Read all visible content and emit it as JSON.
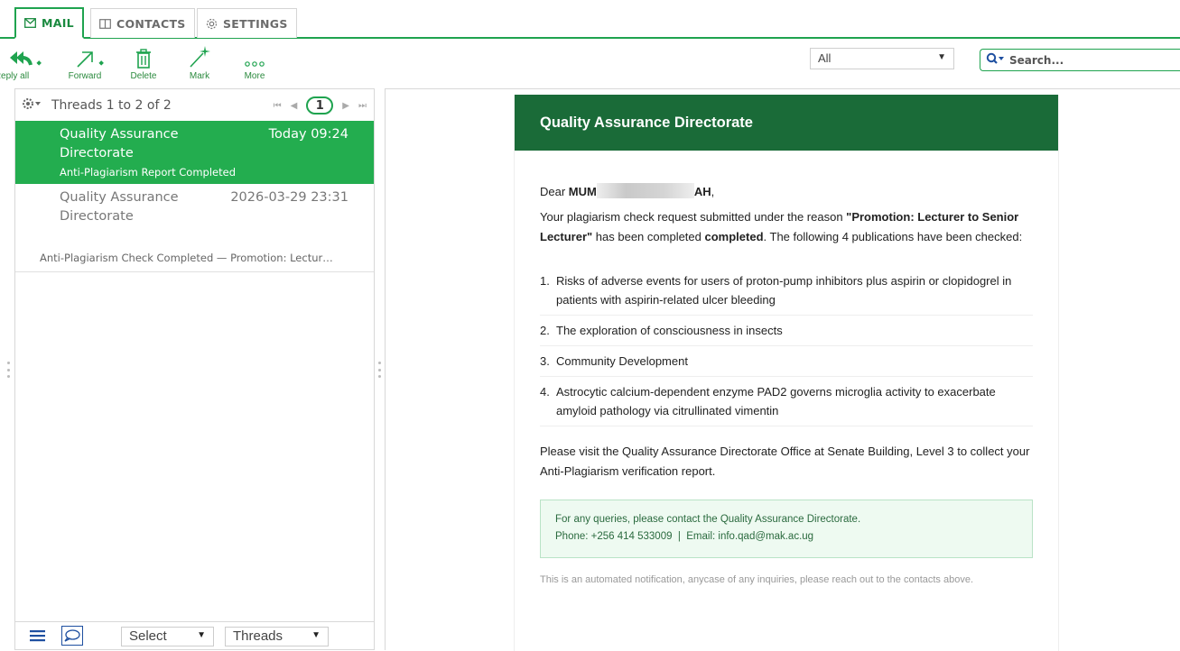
{
  "tabs": [
    {
      "label": "MAIL",
      "icon": "envelope-icon",
      "active": true
    },
    {
      "label": "CONTACTS",
      "icon": "book-icon",
      "active": false
    },
    {
      "label": "SETTINGS",
      "icon": "gear-icon",
      "active": false
    }
  ],
  "toolbar": {
    "reply_all": "Reply all",
    "forward": "Forward",
    "delete": "Delete",
    "mark": "Mark",
    "more": "More"
  },
  "filter": {
    "value": "All"
  },
  "search": {
    "placeholder": "Search..."
  },
  "list": {
    "header": "Threads 1 to 2 of 2",
    "page": "1",
    "threads": [
      {
        "from": "Quality Assurance Directorate",
        "date": "Today 09:24",
        "subject": "Anti-Plagiarism Report Completed",
        "selected": true
      },
      {
        "from": "Quality Assurance Directorate",
        "date": "2026-03-29 23:31",
        "preview": "Anti-Plagiarism Check Completed — Promotion: Lectur…",
        "selected": false
      }
    ],
    "footer": {
      "select": "Select",
      "mode": "Threads"
    }
  },
  "email": {
    "banner": "Quality Assurance Directorate",
    "greeting_prefix": "Dear ",
    "name_start": "MUM",
    "name_end": "AH",
    "greeting_suffix": ",",
    "para1_a": "Your plagiarism check request submitted under the reason ",
    "para1_reason": "\"Promotion: Lecturer to Senior Lecturer\"",
    "para1_b": " has been completed ",
    "para1_completed": "completed",
    "para1_c": ". The following 4 publications have been checked:",
    "publications": [
      {
        "num": "1.",
        "title": "Risks of adverse events for users of proton-pump inhibitors plus aspirin or clopidogrel in patients with aspirin-related ulcer bleeding"
      },
      {
        "num": "2.",
        "title": "The exploration of consciousness in insects"
      },
      {
        "num": "3.",
        "title": "Community Development"
      },
      {
        "num": "4.",
        "title": "Astrocytic calcium-dependent enzyme PAD2 governs microglia activity to exacerbate amyloid pathology via citrullinated vimentin"
      }
    ],
    "visit": "Please visit the Quality Assurance Directorate Office at Senate Building, Level 3 to collect your Anti-Plagiarism verification report.",
    "contact_line1": "For any queries, please contact the Quality Assurance Directorate.",
    "contact_line2": "Phone: +256 414 533009  |  Email: info.qad@mak.ac.ug",
    "automated": "This is an automated notification, anycase of any inquiries, please reach out to the contacts above."
  },
  "colors": {
    "accent": "#1fa34f",
    "banner": "#1a6b38",
    "selected_row": "#23ad4f"
  }
}
